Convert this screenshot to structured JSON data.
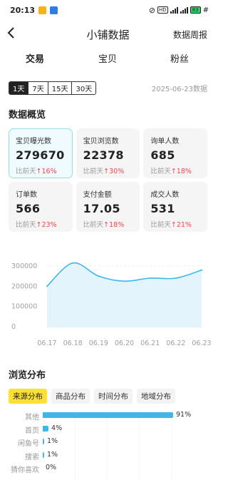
{
  "status_bar": {
    "time": "20:13",
    "right_text": "5G 5G 83 #",
    "net_label": "HD",
    "battery": "83"
  },
  "header": {
    "back_icon": "chevron-left-icon",
    "title": "小铺数据",
    "weekly_report": "数据周报"
  },
  "tabs": [
    {
      "label": "交易",
      "active": true
    },
    {
      "label": "宝贝",
      "active": false
    },
    {
      "label": "粉丝",
      "active": false
    }
  ],
  "day_range": {
    "options": [
      "1天",
      "7天",
      "15天",
      "30天"
    ],
    "selected": "1天",
    "date_label": "2025-06-23数据"
  },
  "overview": {
    "title": "数据概览",
    "compare_prefix": "比前天",
    "up_arrow": "↑",
    "cards": [
      {
        "label": "宝贝曝光数",
        "value": "279670",
        "change": "16%",
        "active": true
      },
      {
        "label": "宝贝浏览数",
        "value": "22378",
        "change": "30%",
        "active": false
      },
      {
        "label": "询单人数",
        "value": "685",
        "change": "18%",
        "active": false
      },
      {
        "label": "订单数",
        "value": "566",
        "change": "23%",
        "active": false
      },
      {
        "label": "支付金额",
        "value": "17.05",
        "change": "18%",
        "active": false
      },
      {
        "label": "成交人数",
        "value": "531",
        "change": "21%",
        "active": false
      }
    ]
  },
  "chart_data": {
    "type": "area",
    "x": [
      "06.17",
      "06.18",
      "06.19",
      "06.20",
      "06.21",
      "06.22",
      "06.23"
    ],
    "series": [
      {
        "values": [
          200000,
          315000,
          250000,
          225000,
          240000,
          240000,
          280000
        ]
      }
    ],
    "yticks": [
      "0",
      "100000",
      "200000",
      "300000"
    ],
    "ylim": [
      0,
      300000
    ],
    "grid": true,
    "color": "#3fb5e8",
    "fill": "#e3f4fc"
  },
  "browse": {
    "title": "浏览分布",
    "subtabs": [
      {
        "label": "来源分布",
        "active": true
      },
      {
        "label": "商品分布",
        "active": false
      },
      {
        "label": "时间分布",
        "active": false
      },
      {
        "label": "地域分布",
        "active": false
      }
    ],
    "rows": [
      {
        "label": "其他",
        "pct": "91%",
        "value": 91
      },
      {
        "label": "首页",
        "pct": "4%",
        "value": 4
      },
      {
        "label": "闲鱼号",
        "pct": "1%",
        "value": 1
      },
      {
        "label": "搜索",
        "pct": "1%",
        "value": 1
      },
      {
        "label": "猜你喜欢",
        "pct": "0%",
        "value": 0
      }
    ]
  }
}
